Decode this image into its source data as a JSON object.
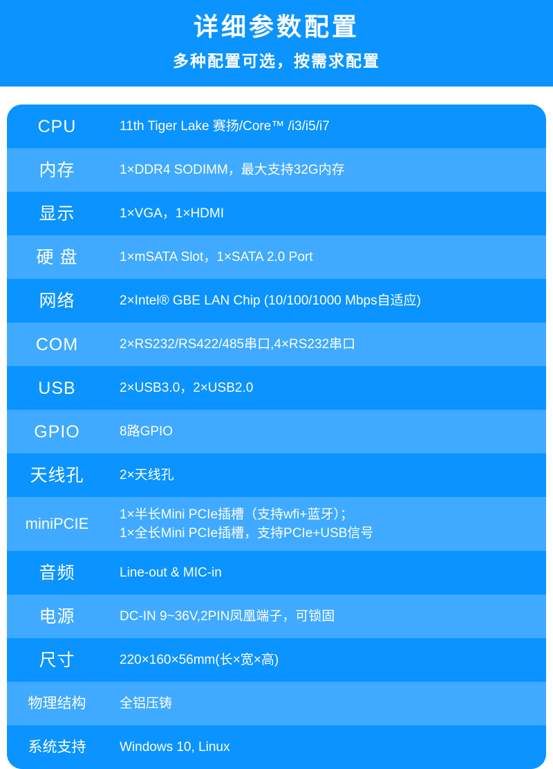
{
  "header": {
    "title": "详细参数配置",
    "subtitle": "多种配置可选，按需求配置",
    "background_color": "#0b93ff",
    "text_color": "#ffffff"
  },
  "table": {
    "row_color_odd": "#0b93ff",
    "row_color_even": "#3faaff",
    "corner_radius_px": 22,
    "rows": [
      {
        "label": "CPU",
        "value": "11th Tiger Lake 赛扬/Core™ /i3/i5/i7"
      },
      {
        "label": "内存",
        "value": "1×DDR4 SODIMM，最大支持32G内存"
      },
      {
        "label": "显示",
        "value": "1×VGA，1×HDMI"
      },
      {
        "label": "硬 盘",
        "value": "1×mSATA Slot，1×SATA 2.0 Port"
      },
      {
        "label": "网络",
        "value": "2×Intel® GBE LAN Chip (10/100/1000 Mbps自适应)"
      },
      {
        "label": "COM",
        "value": "2×RS232/RS422/485串口,4×RS232串口"
      },
      {
        "label": "USB",
        "value": "2×USB3.0，2×USB2.0"
      },
      {
        "label": "GPIO",
        "value": "8路GPIO"
      },
      {
        "label": "天线孔",
        "value": "2×天线孔"
      },
      {
        "label": "miniPCIE",
        "value": "1×半长Mini PCIe插槽（支持wfi+蓝牙）；\n1×全长Mini PCIe插槽，支持PCIe+USB信号"
      },
      {
        "label": "音频",
        "value": "Line-out & MIC-in"
      },
      {
        "label": "电源",
        "value": "DC-IN 9~36V,2PIN凤凰端子，可锁固"
      },
      {
        "label": "尺寸",
        "value": "220×160×56mm(长×宽×高)"
      },
      {
        "label": "物理结构",
        "value": "全铝压铸"
      },
      {
        "label": "系统支持",
        "value": "Windows 10, Linux"
      }
    ]
  }
}
